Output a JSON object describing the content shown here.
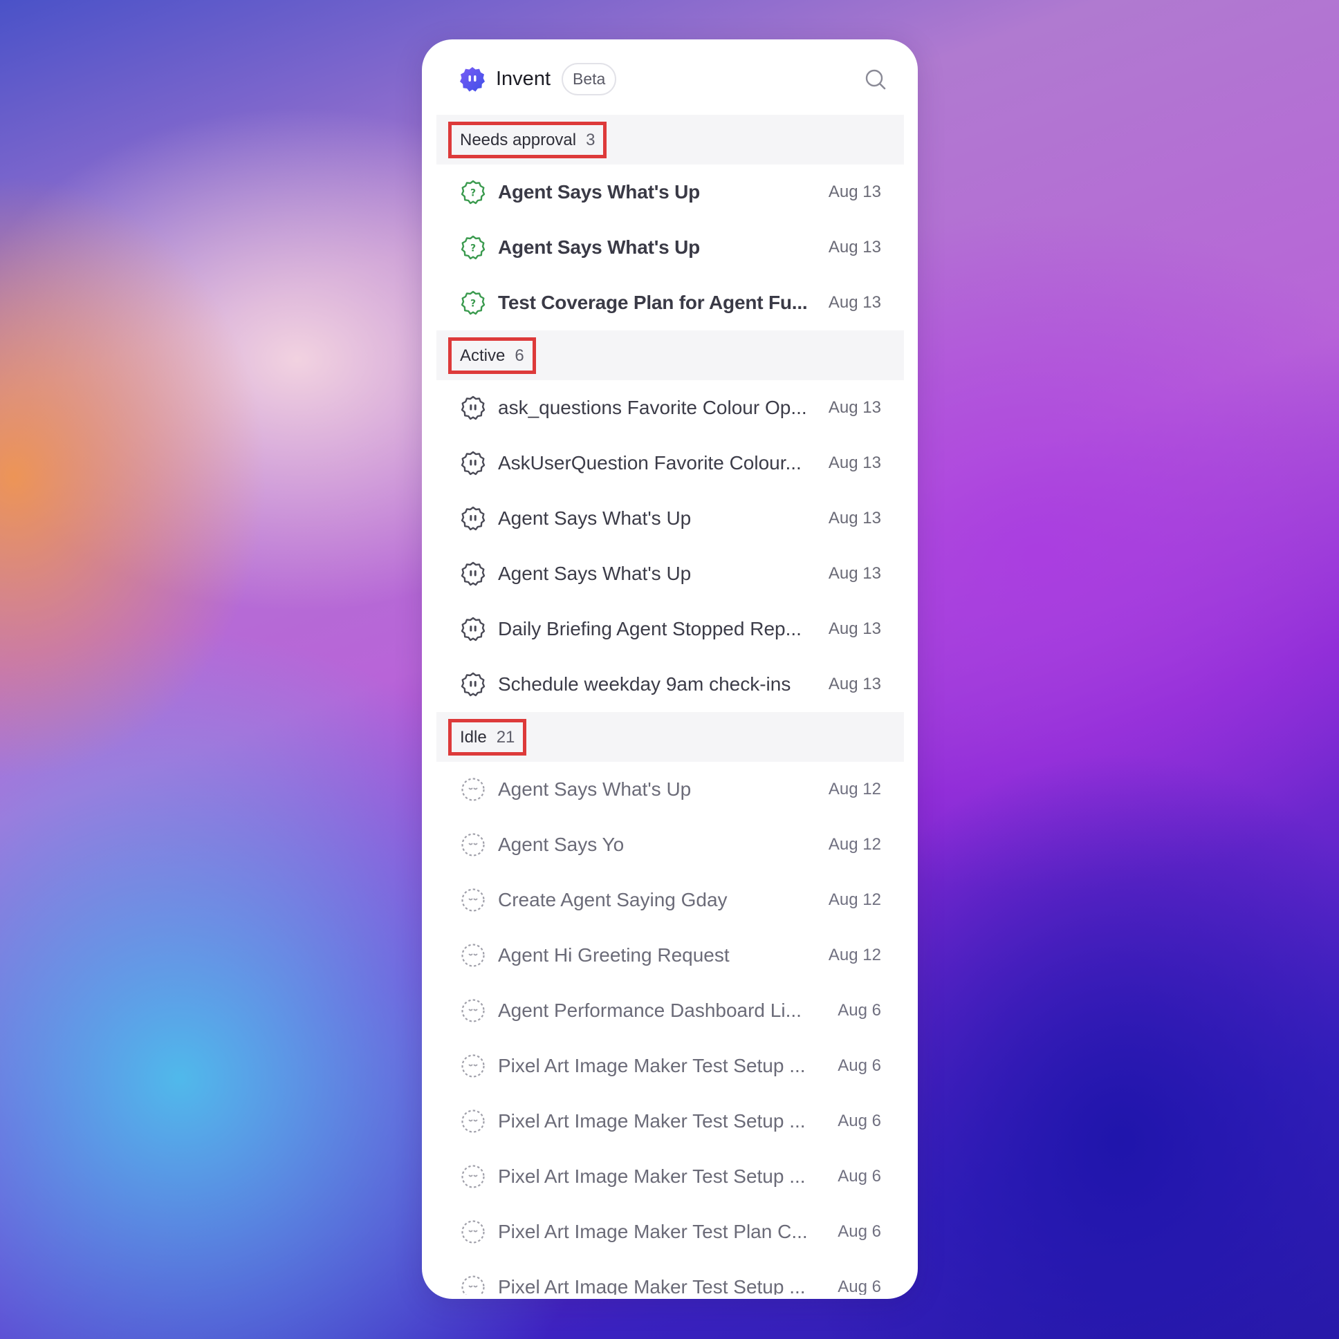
{
  "header": {
    "app_name": "Invent",
    "badge": "Beta",
    "logo_icon": "invent-logo-icon",
    "search_icon": "search-icon"
  },
  "colors": {
    "approval_icon": "#3a9a4e",
    "active_icon": "#4a4a56",
    "idle_icon": "#a0a0aa",
    "highlight_box": "#dd3a3a"
  },
  "sections": [
    {
      "label": "Needs approval",
      "count": "3",
      "icon": "question-badge-icon",
      "items": [
        {
          "title": "Agent Says What's Up",
          "date": "Aug 13"
        },
        {
          "title": "Agent Says What's Up",
          "date": "Aug 13"
        },
        {
          "title": "Test Coverage Plan for Agent Fu...",
          "date": "Aug 13"
        }
      ]
    },
    {
      "label": "Active",
      "count": "6",
      "icon": "agent-face-icon",
      "items": [
        {
          "title": "ask_questions Favorite Colour Op...",
          "date": "Aug 13"
        },
        {
          "title": "AskUserQuestion Favorite Colour...",
          "date": "Aug 13"
        },
        {
          "title": "Agent Says What's Up",
          "date": "Aug 13"
        },
        {
          "title": "Agent Says What's Up",
          "date": "Aug 13"
        },
        {
          "title": "Daily Briefing Agent Stopped Rep...",
          "date": "Aug 13"
        },
        {
          "title": "Schedule weekday 9am check-ins",
          "date": "Aug 13"
        }
      ]
    },
    {
      "label": "Idle",
      "count": "21",
      "icon": "sleeping-agent-icon",
      "items": [
        {
          "title": "Agent Says What's Up",
          "date": "Aug 12"
        },
        {
          "title": "Agent Says Yo",
          "date": "Aug 12"
        },
        {
          "title": "Create Agent Saying Gday",
          "date": "Aug 12"
        },
        {
          "title": "Agent Hi Greeting Request",
          "date": "Aug 12"
        },
        {
          "title": "Agent Performance Dashboard Li...",
          "date": "Aug 6"
        },
        {
          "title": "Pixel Art Image Maker Test Setup ...",
          "date": "Aug 6"
        },
        {
          "title": "Pixel Art Image Maker Test Setup ...",
          "date": "Aug 6"
        },
        {
          "title": "Pixel Art Image Maker Test Setup ...",
          "date": "Aug 6"
        },
        {
          "title": "Pixel Art Image Maker Test Plan C...",
          "date": "Aug 6"
        },
        {
          "title": "Pixel Art Image Maker Test Setup ...",
          "date": "Aug 6"
        }
      ]
    }
  ]
}
